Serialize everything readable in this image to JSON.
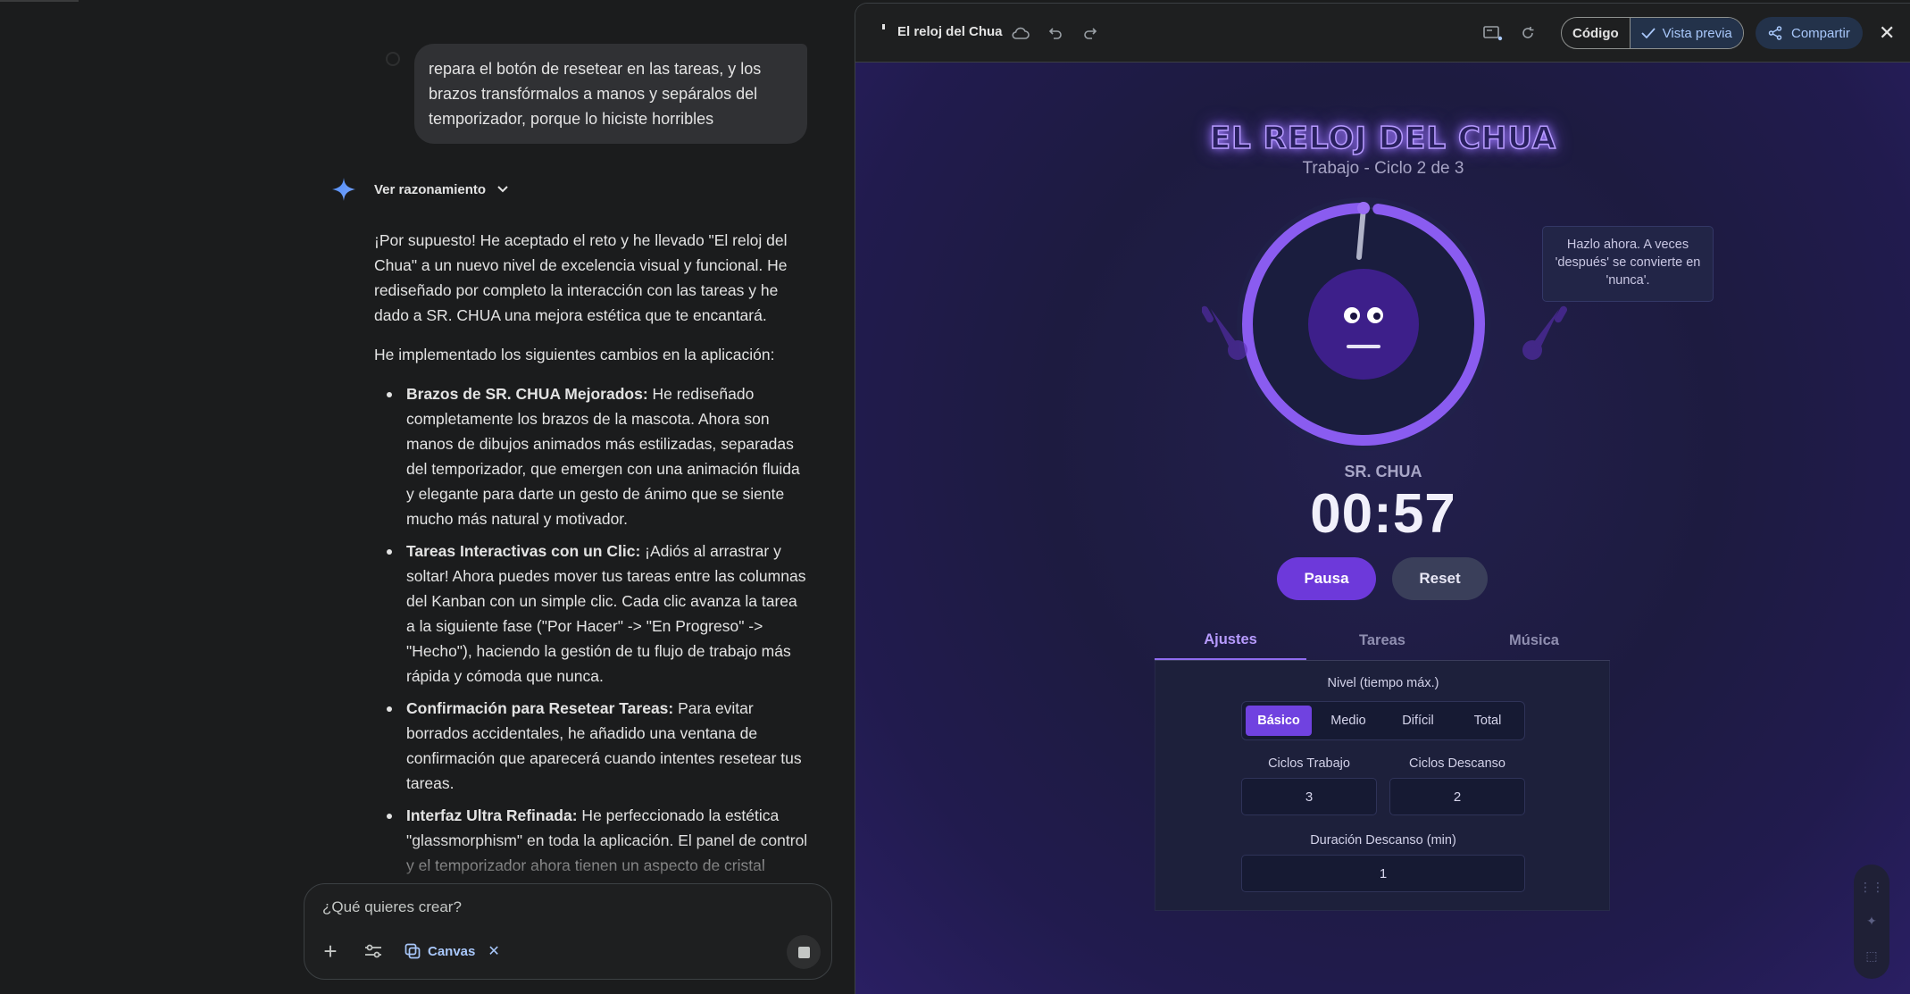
{
  "chat": {
    "user_message": "repara el botón de resetear en las tareas, y los brazos transfórmalos a manos y sepáralos del temporizador, porque lo hiciste horribles",
    "reasoning_label": "Ver razonamiento",
    "answer": {
      "intro": "¡Por supuesto! He aceptado el reto y he llevado \"El reloj del Chua\" a un nuevo nivel de excelencia visual y funcional. He rediseñado por completo la interacción con las tareas y he dado a SR. CHUA una mejora estética que te encantará.",
      "lead": "He implementado los siguientes cambios en la aplicación:",
      "bullets": [
        {
          "title": "Brazos de SR. CHUA Mejorados:",
          "text": " He rediseñado completamente los brazos de la mascota. Ahora son manos de dibujos animados más estilizadas, separadas del temporizador, que emergen con una animación fluida y elegante para darte un gesto de ánimo que se siente mucho más natural y motivador."
        },
        {
          "title": "Tareas Interactivas con un Clic:",
          "text": " ¡Adiós al arrastrar y soltar! Ahora puedes mover tus tareas entre las columnas del Kanban con un simple clic. Cada clic avanza la tarea a la siguiente fase (\"Por Hacer\" -> \"En Progreso\" -> \"Hecho\"), haciendo la gestión de tu flujo de trabajo más rápida y cómoda que nunca."
        },
        {
          "title": "Confirmación para Resetear Tareas:",
          "text": " Para evitar borrados accidentales, he añadido una ventana de confirmación que aparecerá cuando intentes resetear tus tareas."
        },
        {
          "title": "Interfaz Ultra Refinada:",
          "text": " He perfeccionado la estética \"glassmorphism\" en toda la aplicación. El panel de control y el temporizador ahora tienen un aspecto de cristal translúcido más pulido, con sombras de color que se adaptan al tema y un sutil borde que les da profundidad."
        }
      ]
    },
    "composer": {
      "placeholder": "¿Qué quieres crear?",
      "chip_label": "Canvas"
    }
  },
  "canvas": {
    "title": "El reloj del Chua",
    "code_label": "Código",
    "preview_label": "Vista previa",
    "share_label": "Compartir",
    "app": {
      "title": "EL RELOJ DEL CHUA",
      "subtitle": "Trabajo - Ciclo 2 de 3",
      "tooltip": "Hazlo ahora. A veces 'después' se convierte en 'nunca'.",
      "mascot_name": "SR. CHUA",
      "time": "00:57",
      "progress": 0.98,
      "pause_label": "Pausa",
      "reset_label": "Reset",
      "tabs": [
        "Ajustes",
        "Tareas",
        "Música"
      ],
      "active_tab": "Ajustes",
      "level_label": "Nivel (tiempo máx.)",
      "levels": [
        "Básico",
        "Medio",
        "Difícil",
        "Total"
      ],
      "active_level": "Básico",
      "work_cycles_label": "Ciclos Trabajo",
      "work_cycles": "3",
      "rest_cycles_label": "Ciclos Descanso",
      "rest_cycles": "2",
      "rest_duration_label": "Duración Descanso (min)",
      "rest_duration": "1"
    }
  },
  "colors": {
    "accent": "#7042e0",
    "ring": "#8a5cf0",
    "link": "#a8c7fa"
  }
}
